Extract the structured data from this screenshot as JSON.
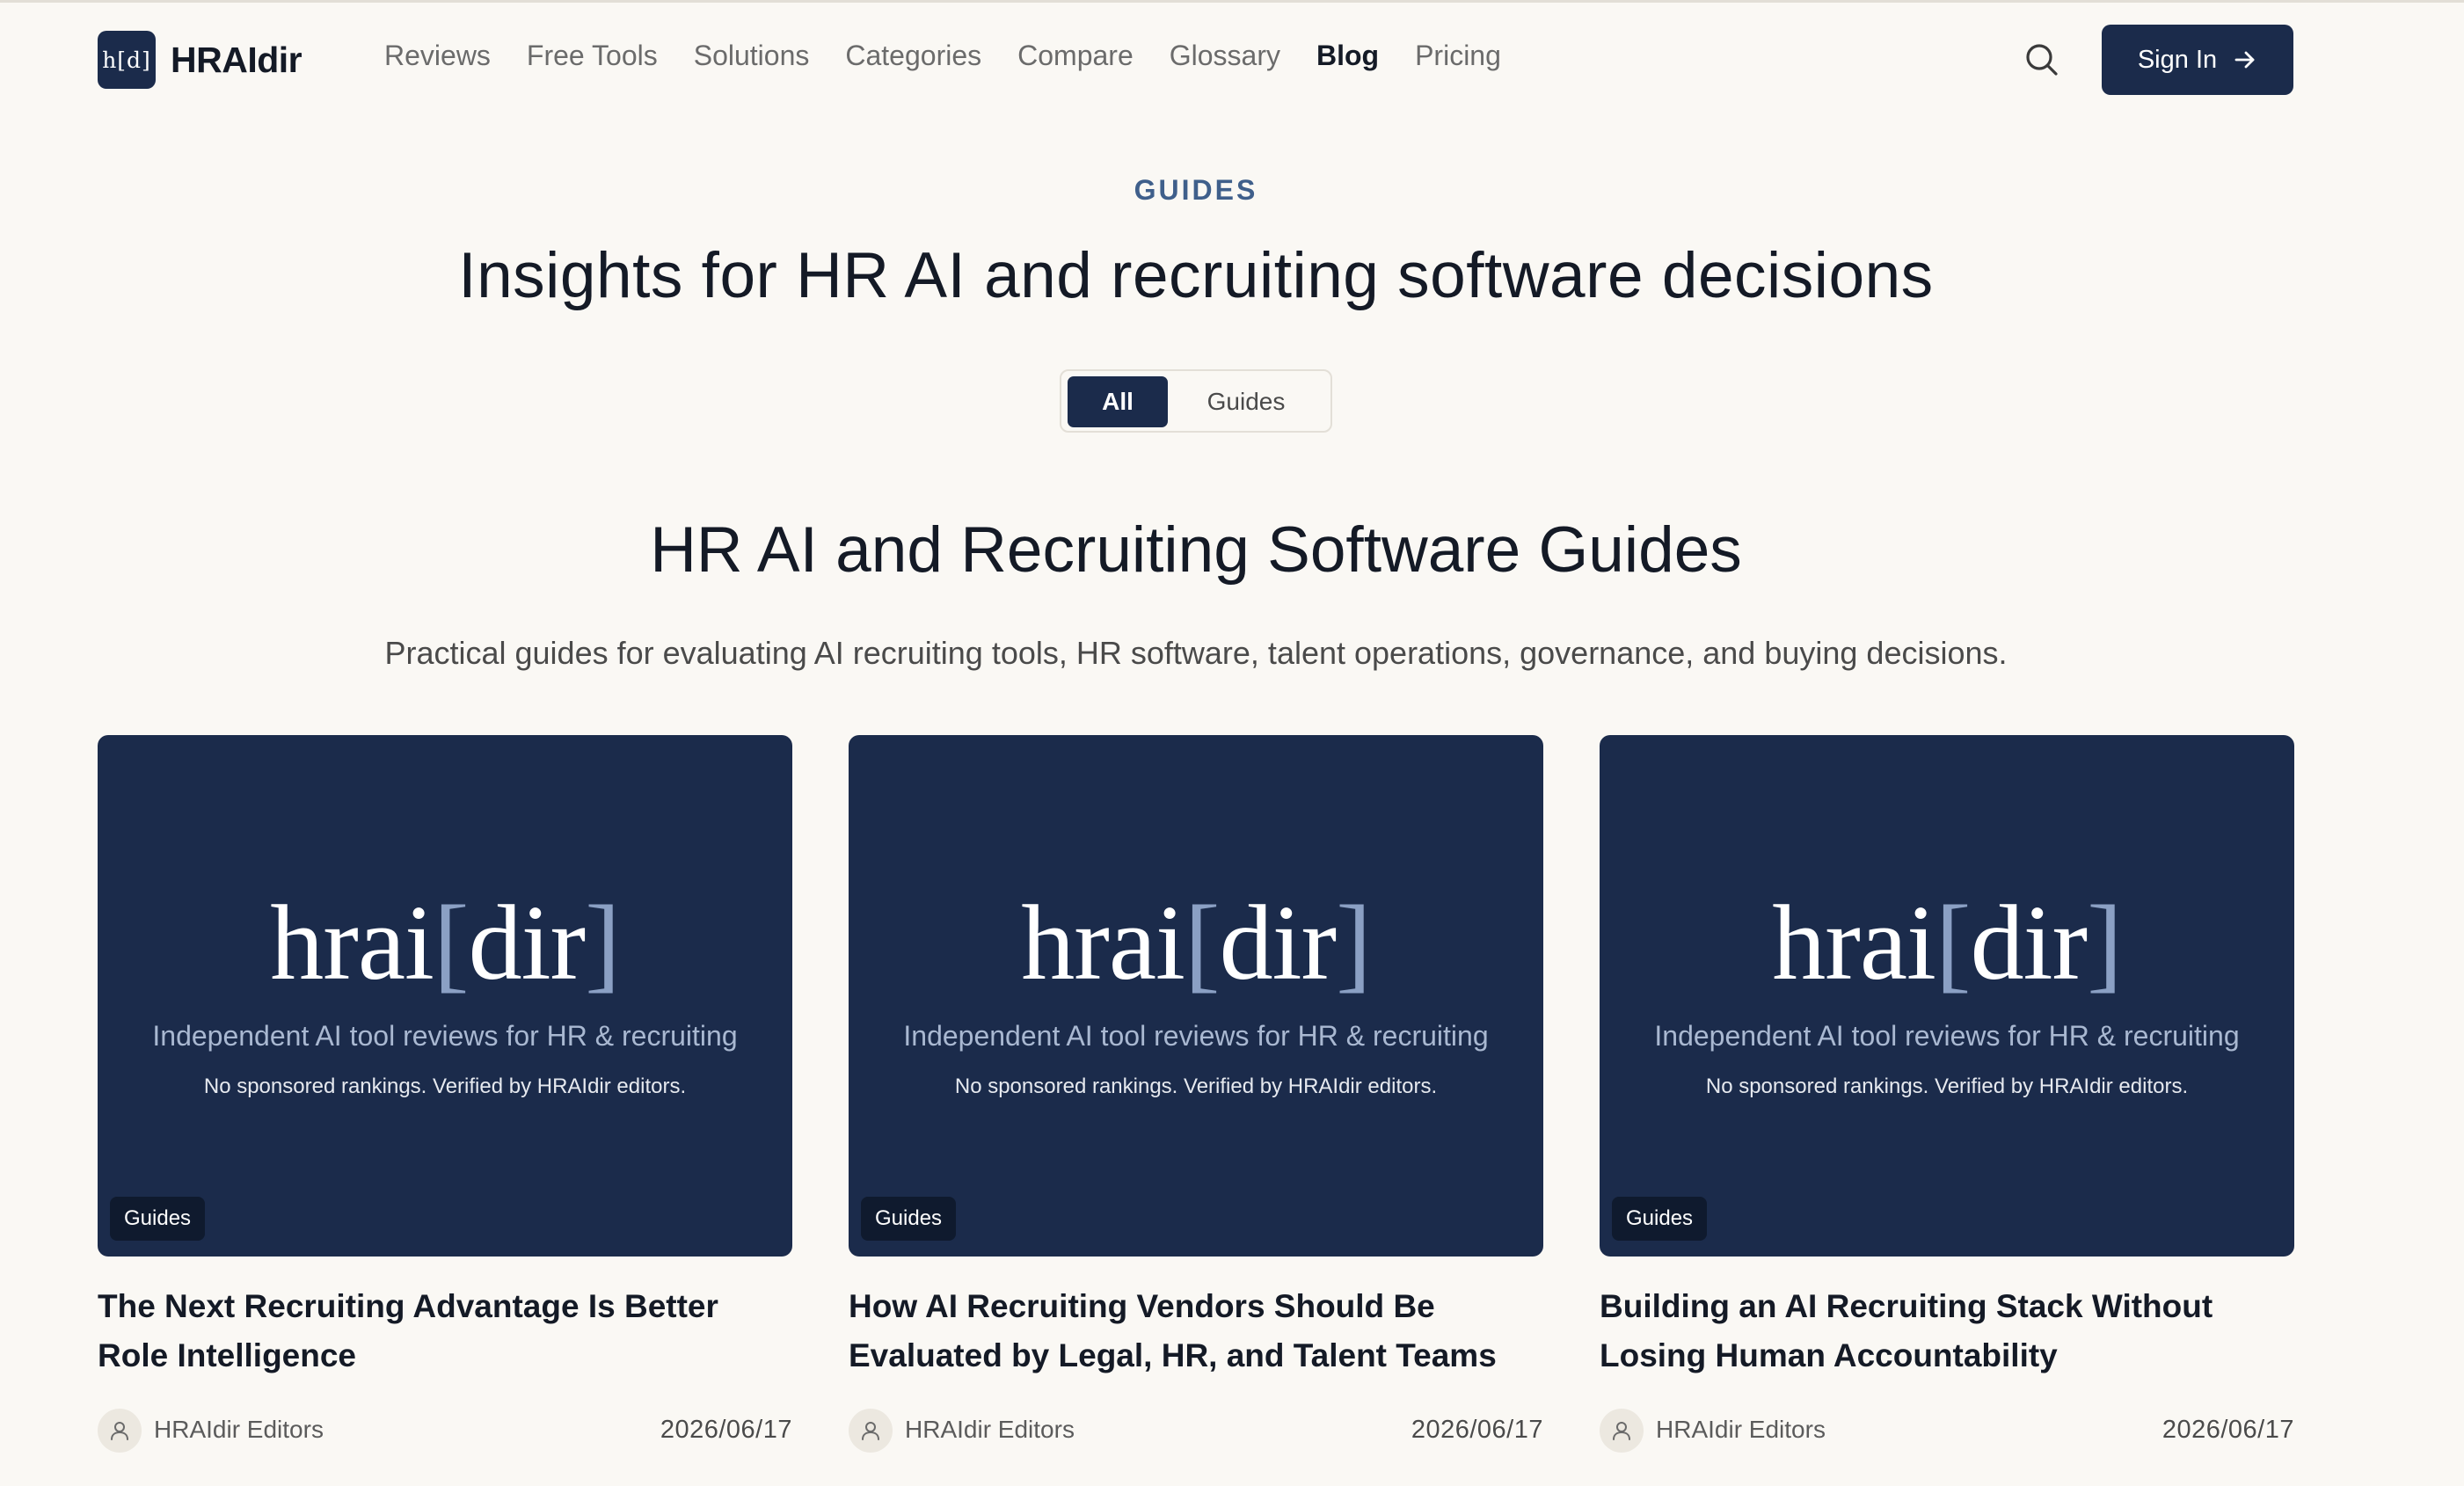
{
  "brand": {
    "mark": "h[d]",
    "name": "HRAIdir"
  },
  "nav": {
    "items": [
      {
        "label": "Reviews"
      },
      {
        "label": "Free Tools"
      },
      {
        "label": "Solutions"
      },
      {
        "label": "Categories"
      },
      {
        "label": "Compare"
      },
      {
        "label": "Glossary"
      },
      {
        "label": "Blog",
        "active": true
      },
      {
        "label": "Pricing"
      }
    ],
    "search_icon": "search-icon",
    "signin_label": "Sign In",
    "signin_icon": "arrow-right-icon"
  },
  "hero": {
    "kicker": "GUIDES",
    "title": "Insights for HR AI and recruiting software decisions"
  },
  "filters": {
    "all": "All",
    "guides": "Guides",
    "selected": "All"
  },
  "section": {
    "title": "HR AI and Recruiting Software Guides",
    "subtitle": "Practical guides for evaluating AI recruiting tools, HR software, talent operations, governance, and buying decisions."
  },
  "thumbnail": {
    "brand_left": "hrai",
    "brand_open": "[",
    "brand_mid": "dir",
    "brand_close": "]",
    "tagline": "Independent AI tool reviews for HR & recruiting",
    "subtag": "No sponsored rankings. Verified by HRAIdir editors."
  },
  "cards": [
    {
      "badge": "Guides",
      "title": "The Next Recruiting Advantage Is Better Role Intelligence",
      "author": "HRAIdir Editors",
      "date": "2026/06/17"
    },
    {
      "badge": "Guides",
      "title": "How AI Recruiting Vendors Should Be Evaluated by Legal, HR, and Talent Teams",
      "author": "HRAIdir Editors",
      "date": "2026/06/17"
    },
    {
      "badge": "Guides",
      "title": "Building an AI Recruiting Stack Without Losing Human Accountability",
      "author": "HRAIdir Editors",
      "date": "2026/06/17"
    }
  ],
  "colors": {
    "background": "#faf8f4",
    "navy": "#1b2b4b",
    "kicker": "#3f5f8b",
    "bracket": "#8ba0c4"
  }
}
